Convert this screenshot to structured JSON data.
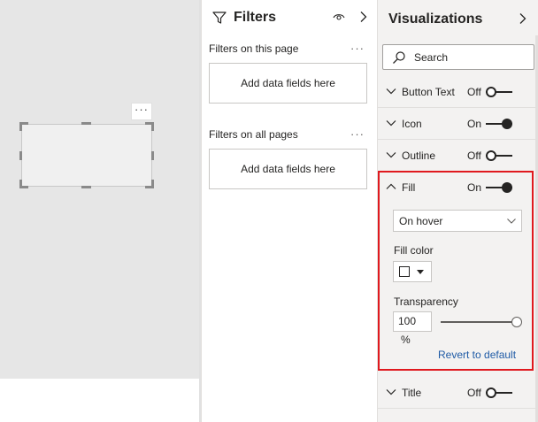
{
  "canvas": {
    "visual_more_label": "···"
  },
  "filters": {
    "title": "Filters",
    "sections": [
      {
        "label": "Filters on this page",
        "more": "···",
        "well": "Add data fields here"
      },
      {
        "label": "Filters on all pages",
        "more": "···",
        "well": "Add data fields here"
      }
    ]
  },
  "visualizations": {
    "title": "Visualizations",
    "search_placeholder": "Search",
    "cards": [
      {
        "label": "Button Text",
        "state": "Off"
      },
      {
        "label": "Icon",
        "state": "On"
      },
      {
        "label": "Outline",
        "state": "Off"
      },
      {
        "label": "Fill",
        "state": "On"
      },
      {
        "label": "Title",
        "state": "Off"
      }
    ],
    "fill": {
      "state_select": "On hover",
      "fill_color_label": "Fill color",
      "fill_color": "#ffffff",
      "transparency_label": "Transparency",
      "transparency_value": "100",
      "transparency_unit": "%",
      "transparency_fraction": 1.0,
      "revert_label": "Revert to default",
      "highlight_color": "#e0191e"
    }
  }
}
